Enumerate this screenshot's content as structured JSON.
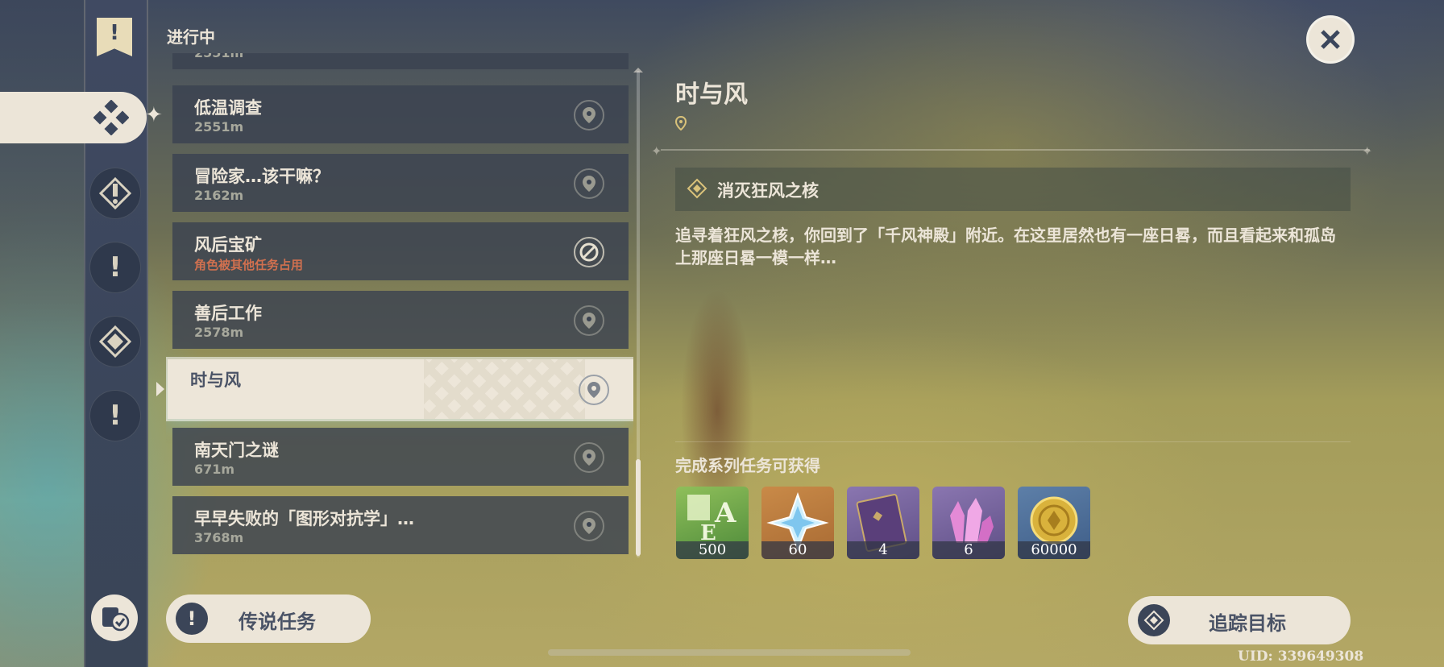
{
  "header": {
    "category_title": "进行中"
  },
  "quests": [
    {
      "title": "",
      "sub": "2551m",
      "state": "partial"
    },
    {
      "title": "低温调查",
      "sub": "2551m",
      "state": "normal"
    },
    {
      "title": "冒险家…该干嘛？",
      "sub": "2162m",
      "state": "normal"
    },
    {
      "title": "风后宝矿",
      "sub": "角色被其他任务占用",
      "state": "blocked"
    },
    {
      "title": "善后工作",
      "sub": "2578m",
      "state": "normal"
    },
    {
      "title": "时与风",
      "sub": "",
      "state": "selected"
    },
    {
      "title": "南天门之谜",
      "sub": "671m",
      "state": "normal"
    },
    {
      "title": "早早失败的「图形对抗学」…",
      "sub": "3768m",
      "state": "normal"
    }
  ],
  "legend_button": {
    "label": "传说任务"
  },
  "detail": {
    "title": "时与风",
    "objective": "消灭狂风之核",
    "description": "追寻着狂风之核，你回到了「千风神殿」附近。在这里居然也有一座日晷，而且看起来和孤岛上那座日晷一模一样…",
    "rewards_title": "完成系列任务可获得",
    "rewards": [
      {
        "name": "adventure-exp",
        "count": "500"
      },
      {
        "name": "primogem",
        "count": "60"
      },
      {
        "name": "heros-wit-book",
        "count": "4"
      },
      {
        "name": "mystic-enhancement-ore",
        "count": "6"
      },
      {
        "name": "mora",
        "count": "60000"
      }
    ]
  },
  "track_button": {
    "label": "追踪目标"
  },
  "uid": "UID: 339649308",
  "colors": {
    "panel": "#3a4250",
    "cream": "#ece5d8",
    "text_dark": "#4a5366",
    "warning": "#d0704f"
  }
}
